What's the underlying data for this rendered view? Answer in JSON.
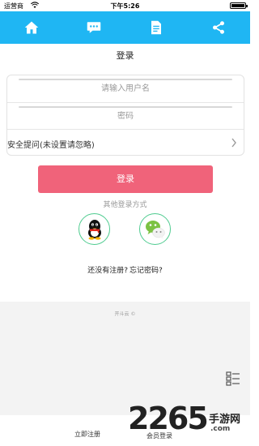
{
  "status_bar": {
    "carrier": "运营商",
    "time": "下午5:26"
  },
  "top_nav": {
    "items": [
      {
        "icon": "home-icon"
      },
      {
        "icon": "message-icon"
      },
      {
        "icon": "document-icon"
      },
      {
        "icon": "share-icon"
      }
    ],
    "background_color": "#1fb6f3"
  },
  "login_form": {
    "title": "登录",
    "username_placeholder": "请输入用户名",
    "password_placeholder": "密码",
    "security_question_label": "安全提问(未设置请忽略)",
    "login_button_label": "登录",
    "login_button_color": "#f0637a",
    "other_login_label": "其他登录方式",
    "social_logins": [
      {
        "icon": "qq-icon"
      },
      {
        "icon": "wechat-icon"
      }
    ]
  },
  "links": {
    "register_text": "还没有注册?",
    "forgot_text": "忘记密码?"
  },
  "footer": {
    "powered_text": "开斗云 ©"
  },
  "bottom_nav": {
    "register_now": "立即注册",
    "member_login": "会员登录"
  },
  "watermark": {
    "number": "2265",
    "text": "手游网",
    "url": ".com"
  }
}
